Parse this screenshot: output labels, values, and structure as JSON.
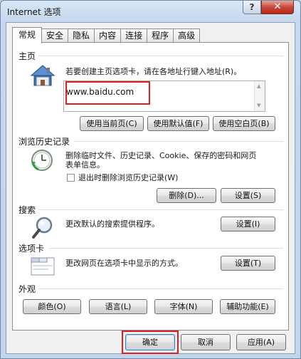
{
  "window": {
    "title": "Internet 选项"
  },
  "titlebar": {
    "help_glyph": "?",
    "close_glyph": "✕"
  },
  "tabs": [
    {
      "label": "常规",
      "active": true
    },
    {
      "label": "安全"
    },
    {
      "label": "隐私"
    },
    {
      "label": "内容"
    },
    {
      "label": "连接"
    },
    {
      "label": "程序"
    },
    {
      "label": "高级"
    }
  ],
  "homepage": {
    "title": "主页",
    "description": "若要创建主页选项卡，请在各地址行键入地址(R)。",
    "url_value": "www.baidu.com",
    "buttons": [
      "使用当前页(C)",
      "使用默认值(F)",
      "使用空白页(B)"
    ]
  },
  "history": {
    "title": "浏览历史记录",
    "description_line1": "删除临时文件、历史记录、Cookie、保存的密码和网页",
    "description_line2": "表单信息。",
    "checkbox_label": "退出时删除浏览历史记录(W)",
    "checkbox_checked": false,
    "delete_button": "删除(D)...",
    "settings_button": "设置(S)"
  },
  "search": {
    "title": "搜索",
    "description": "更改默认的搜索提供程序。",
    "settings_button": "设置(I)"
  },
  "tabs_section": {
    "title": "选项卡",
    "description": "更改网页在选项卡中显示的方式。",
    "settings_button": "设置(T)"
  },
  "appearance": {
    "title": "外观",
    "buttons": [
      "颜色(O)",
      "语言(L)",
      "字体(N)",
      "辅助功能(E)"
    ]
  },
  "footer": {
    "ok_button": "确定",
    "cancel_button": "取消",
    "apply_button": "应用(A)"
  },
  "colors": {
    "highlight": "#e02020",
    "close_button": "#c8483a"
  }
}
